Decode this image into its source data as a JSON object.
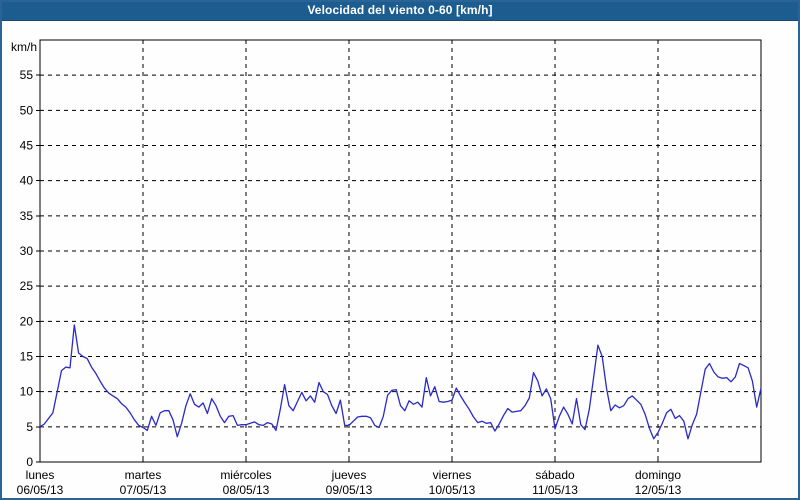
{
  "window": {
    "title": "Velocidad del viento 0-60 [km/h]"
  },
  "colors": {
    "header_bg": "#1D5C8E",
    "header_text": "#FFFFFF",
    "outer_frame": "#2A6496",
    "background": "#FDFEFD",
    "plot_border": "#000000",
    "grid": "#000000",
    "line": "#2A2AC8",
    "text": "#000000"
  },
  "chart_data": {
    "type": "line",
    "title": "Velocidad del viento 0-60 [km/h]",
    "ylabel": "km/h",
    "xlabel": "",
    "ylim": [
      0,
      60
    ],
    "y_ticks": [
      0,
      5,
      10,
      15,
      20,
      25,
      30,
      35,
      40,
      45,
      50,
      55
    ],
    "grid": "dashed, horizontal at every 5 km/h, vertical at each day boundary",
    "legend": "none",
    "x_categories": [
      "lunes",
      "martes",
      "miércoles",
      "jueves",
      "viernes",
      "sábado",
      "domingo"
    ],
    "x_dates": [
      "06/05/13",
      "07/05/13",
      "08/05/13",
      "09/05/13",
      "10/05/13",
      "11/05/13",
      "12/05/13"
    ],
    "points_per_day": 24,
    "series": [
      {
        "name": "Velocidad del viento (km/h)",
        "color": "#2A2AC8",
        "values": [
          5.0,
          5.4,
          6.2,
          7.0,
          10.0,
          13.0,
          13.5,
          13.4,
          19.5,
          15.5,
          15.0,
          14.7,
          13.5,
          12.6,
          11.5,
          10.5,
          9.8,
          9.4,
          9.0,
          8.3,
          7.8,
          7.0,
          6.0,
          5.2,
          4.9,
          4.5,
          6.5,
          5.2,
          7.0,
          7.3,
          7.3,
          6.0,
          3.6,
          5.5,
          8.0,
          9.7,
          8.2,
          7.8,
          8.4,
          6.9,
          9.0,
          8.0,
          6.5,
          5.6,
          6.5,
          6.6,
          5.2,
          5.3,
          5.3,
          5.5,
          5.7,
          5.3,
          5.2,
          5.6,
          5.4,
          4.5,
          7.5,
          11.0,
          8.0,
          7.3,
          8.6,
          9.9,
          8.7,
          9.4,
          8.5,
          11.3,
          10.0,
          9.6,
          8.0,
          6.9,
          8.8,
          5.2,
          5.2,
          5.8,
          6.4,
          6.5,
          6.5,
          6.3,
          5.2,
          4.9,
          6.5,
          9.5,
          10.2,
          10.3,
          8.0,
          7.3,
          8.7,
          8.2,
          8.5,
          7.8,
          12.0,
          9.4,
          10.7,
          8.6,
          8.5,
          8.6,
          8.8,
          10.5,
          9.4,
          8.4,
          7.5,
          6.4,
          5.6,
          5.8,
          5.5,
          5.6,
          4.4,
          5.4,
          6.6,
          7.6,
          7.1,
          7.2,
          7.3,
          8.0,
          9.1,
          12.7,
          11.5,
          9.4,
          10.4,
          9.0,
          4.7,
          6.5,
          7.8,
          6.8,
          5.4,
          9.0,
          5.3,
          4.6,
          7.5,
          12.0,
          16.6,
          15.0,
          10.5,
          7.3,
          8.1,
          7.7,
          8.0,
          9.0,
          9.4,
          8.8,
          8.2,
          6.8,
          4.8,
          3.3,
          4.2,
          5.5,
          7.0,
          7.5,
          6.2,
          6.6,
          5.8,
          3.3,
          5.3,
          6.8,
          10.0,
          13.2,
          14.0,
          12.8,
          12.1,
          11.9,
          12.0,
          11.4,
          12.1,
          14.0,
          13.7,
          13.4,
          11.5,
          7.8,
          10.5
        ]
      }
    ]
  }
}
